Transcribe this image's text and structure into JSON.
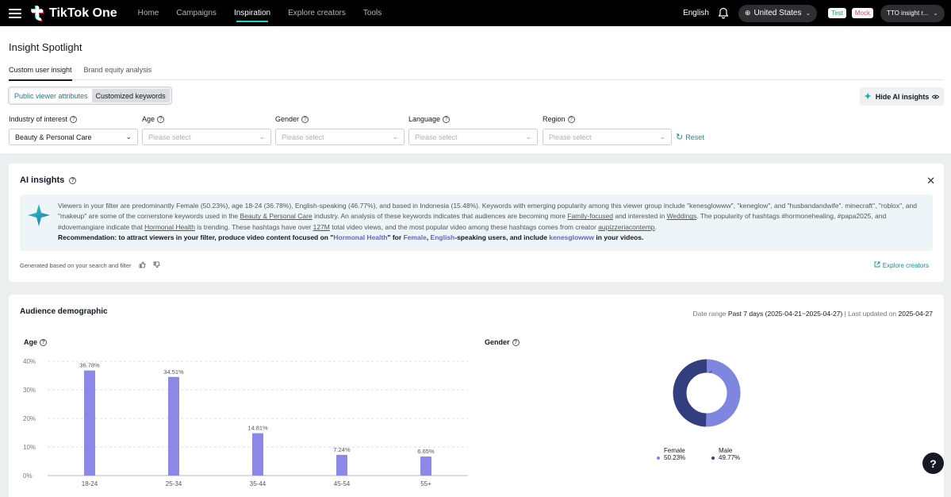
{
  "topbar": {
    "brand": "TikTok One",
    "nav": [
      {
        "label": "Home",
        "active": false
      },
      {
        "label": "Campaigns",
        "active": false
      },
      {
        "label": "Inspiration",
        "active": true
      },
      {
        "label": "Explore creators",
        "active": false
      },
      {
        "label": "Tools",
        "active": false
      }
    ],
    "language": "English",
    "country": "United States",
    "badge_test": "Test",
    "badge_mock": "Mock",
    "account": "TTO insight r..."
  },
  "page": {
    "title": "Insight Spotlight",
    "tabs": [
      "Custom user insight",
      "Brand equity analysis"
    ],
    "segments": [
      "Public viewer attributes",
      "Customized keywords"
    ],
    "hide_ai_label": "Hide AI insights"
  },
  "filters": {
    "industry": {
      "label": "Industry of interest",
      "value": "Beauty & Personal Care"
    },
    "age": {
      "label": "Age",
      "placeholder": "Please select"
    },
    "gender": {
      "label": "Gender",
      "placeholder": "Please select"
    },
    "language": {
      "label": "Language",
      "placeholder": "Please select"
    },
    "region": {
      "label": "Region",
      "placeholder": "Please select"
    },
    "reset_label": "Reset"
  },
  "ai": {
    "title": "AI insights",
    "t1": "Viewers in your filter are predominantly Female (50.23%), age 18-24 (36.78%), English-speaking (46.77%), and based in Indonesia (15.48%). Keywords with emerging popularity among this viewer group include \"kenesglowww\", \"keneglow\", and \"husbandandwife\". minecraft\", \"roblox\", and \"makeup\" are some of the cornerstone keywords used in the ",
    "l1": "Beauty & Personal Care",
    "t2": " industry. An analysis of these keywords indicates that audiences are becoming more ",
    "l2": "Family-focused",
    "t3": " and interested in ",
    "l3": "Weddings",
    "t4": ". The popularity of hashtags #hormonehealing, #papa2025, and #dovemangiare indicate that ",
    "l4": "Hormonal Health",
    "t5": " is trending. These hashtags have over ",
    "l5": "127M",
    "t6": " total video views, and the most popular video among these hashtags comes from creator ",
    "l6": "aupizzeriacontemp",
    "t7": ".",
    "r1": "Recommendation: to attract viewers in your filter, produce video content focused on \"",
    "h1": "Hormonal Health",
    "r2": "\" for ",
    "h2": "Female",
    "r3": ", ",
    "h3": "English",
    "r4": "-speaking users, and include ",
    "h4": "kenesglowww",
    "r5": " in your videos.",
    "footnote": "Generated based on your search and filter",
    "explore_label": "Explore creators"
  },
  "demographic": {
    "title": "Audience demographic",
    "date_prefix": "Date range ",
    "date_value": "Past 7 days (2025-04-21~2025-04-27)",
    "updated_prefix": " | Last updated on ",
    "updated_value": "2025-04-27",
    "age_label": "Age",
    "gender_label": "Gender",
    "gender_legend": [
      {
        "name": "Female",
        "value": "50.23%",
        "color": "#7f86e0"
      },
      {
        "name": "Male",
        "value": "49.77%",
        "color": "#323e7e"
      }
    ]
  },
  "chart_data": [
    {
      "type": "bar",
      "categories": [
        "18-24",
        "25-34",
        "35-44",
        "45-54",
        "55+"
      ],
      "values": [
        36.78,
        34.51,
        14.81,
        7.24,
        6.65
      ],
      "labels": [
        "36.78%",
        "34.51%",
        "14.81%",
        "7.24%",
        "6.65%"
      ],
      "yticks": [
        "0%",
        "10%",
        "20%",
        "30%",
        "40%"
      ],
      "ylim": [
        0,
        40
      ],
      "color": "#8b88e8",
      "title": "Age"
    },
    {
      "type": "pie",
      "categories": [
        "Female",
        "Male"
      ],
      "values": [
        50.23,
        49.77
      ],
      "colors": [
        "#7f86e0",
        "#323e7e"
      ],
      "title": "Gender"
    }
  ]
}
